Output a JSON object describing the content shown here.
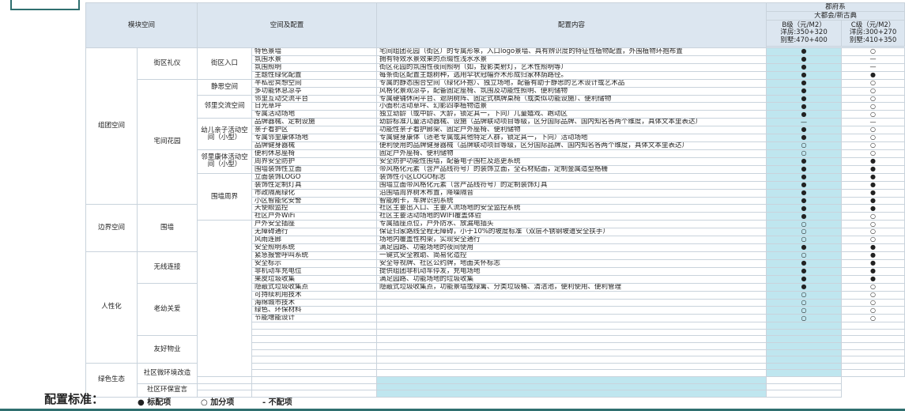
{
  "header": {
    "col_module": "模块空间",
    "col_space": "空间及配置",
    "col_content": "配置内容",
    "series": "郡府系",
    "sub_series": "大都会/新古典",
    "level_b": "B级（元/M2）",
    "level_b_price1": "洋房:350+320",
    "level_b_price2": "别墅:470+400",
    "level_c": "C级（元/M2）",
    "level_c_price1": "洋房:300+270",
    "level_c_price2": "别墅:410+350"
  },
  "groups": [
    {
      "module": "组团空间",
      "rows": 20
    },
    {
      "module": "边界空间",
      "rows": 6
    },
    {
      "module": "人性化",
      "rows": 15
    },
    {
      "module": "绿色生态",
      "rows": 5
    }
  ],
  "subgroups": [
    {
      "name": "街区礼仪",
      "rows": 4
    },
    {
      "name": "宅间花园",
      "rows": 16
    },
    {
      "name": "围墙",
      "rows": 6
    },
    {
      "name": "无线连接",
      "rows": 4
    },
    {
      "name": "老幼关爱",
      "rows": 7
    },
    {
      "name": "友好物业",
      "rows": 4
    },
    {
      "name": "社区微环境改造",
      "rows": 3
    },
    {
      "name": "社区环保宣言",
      "rows": 2
    }
  ],
  "items": [
    {
      "space": "街区入口",
      "rows": 4
    },
    {
      "space": "静思空间",
      "rows": 2
    },
    {
      "space": "邻里交流空间",
      "rows": 3
    },
    {
      "space": "幼儿亲子活动空间（小型）",
      "rows": 4
    },
    {
      "space": "邻里康体活动空间（小型）",
      "rows": 3
    },
    {
      "space": "围墙周界",
      "rows": 6
    }
  ],
  "rows": [
    {
      "config": "特色景墙",
      "content": "宅间组团花园（街区）的专属形象，入口logo景墙、具有辨识度的特征性植物配置，外围植物环抱布置",
      "b": "●",
      "c": "○"
    },
    {
      "config": "氛围水景",
      "content": "拥有特效水景效果的点缀性浅水水景",
      "b": "●",
      "c": "—"
    },
    {
      "config": "氛围照明",
      "content": "街区花园的氛围性夜间照明（如，投影类射灯，艺术性照明等）",
      "b": "●",
      "c": "—"
    },
    {
      "config": "主题性绿化配置",
      "content": "每条街区配置主题树种，选用伞状冠幅乔木形成归家林荫路径。",
      "b": "●",
      "c": "●"
    },
    {
      "config": "半私密冥想空间",
      "content": "专属的静态围合空间（绿化环抱）、独立场地，配备有助于静思的艺术设计或艺术品",
      "b": "●",
      "c": "○"
    },
    {
      "config": "多功能休息凉亭",
      "content": "风格化景观凉亭，配备固定座椅、氛围及功能性照明、便利储物",
      "b": "●",
      "c": "○"
    },
    {
      "config": "邻里互动交流平台",
      "content": "专属硬铺休闲平台、遮阴树阵、固定式棋牌桌椅（或类似功能设施）、便利储物",
      "b": "●",
      "c": "○"
    },
    {
      "config": "日光草坪",
      "content": "小面积活动草坪、幻影四季植物造景",
      "b": "●",
      "c": "○"
    },
    {
      "config": "专属活动场地",
      "content": "独立幼龄（或中龄、大龄，锁定其一，下同）儿童嬉戏、跑动区",
      "b": "●",
      "c": "○"
    },
    {
      "config": "品牌器械、定制设施",
      "content": "幼龄标准儿童活动器械、设施（品牌联动项目等级，区分国际品牌、国内知名各两个维度，具体文本里表达）",
      "b": "—",
      "c": "—"
    },
    {
      "config": "亲子看护区",
      "content": "功能性亲子看护廊架、固定户外座椅、便利储物",
      "b": "●",
      "c": "○"
    },
    {
      "config": "专属邻里康体场地",
      "content": "专属健身康体（适老专属或其他特定人群，锁定其一，下同）活动场地",
      "b": "●",
      "c": "○"
    },
    {
      "config": "品牌健身器械",
      "content": "便利使用的品牌健身器械（品牌联动项目等级，区分国际品牌、国内知名各两个维度，具体文本里表达）",
      "b": "○",
      "c": "○"
    },
    {
      "config": "便利休息座椅",
      "content": "固定户外座椅、便利储物",
      "b": "○",
      "c": "○"
    },
    {
      "config": "周界安全防护",
      "content": "安全防护功能性围墙，配备电子围栏及巡更系统",
      "b": "●",
      "c": "●"
    },
    {
      "config": "围墙装饰性立面",
      "content": "带风格化元素（含产品线符号）的装饰立面，全石材贴面，定制金属造型格栅",
      "b": "●",
      "c": "●"
    },
    {
      "config": "立面装饰LOGO",
      "content": "装饰性小区LOGO标志",
      "b": "●",
      "c": "●"
    },
    {
      "config": "装饰性定制灯具",
      "content": "围墙立面带风格化元素（含产品线符号）的定制装饰灯具",
      "b": "●",
      "c": "●"
    },
    {
      "config": "市政隔离绿化",
      "content": "沿围墙周界树木布置，降噪隔音",
      "b": "●",
      "c": "●"
    },
    {
      "config": "小区智能化安警",
      "content": "智能刷卡，车牌识别系统",
      "b": "●",
      "c": "●"
    },
    {
      "config": "天使眼监控",
      "content": "社区主要出入口、主要人流场地的安全监控系统",
      "b": "●",
      "c": "●"
    },
    {
      "config": "社区户外WiFi",
      "content": "社区主要活动场地的WIFI覆盖体验",
      "b": "●",
      "c": "○"
    },
    {
      "config": "户外安全插座",
      "content": "专属插座点位，户外防水、放漏电插头",
      "b": "○",
      "c": "○"
    },
    {
      "config": "无障碍通行",
      "content": "保证归家路线全程无障碍，小于10%的坡度标准（双层不锈钢坡道安全扶手）",
      "b": "○",
      "c": "○"
    },
    {
      "config": "风雨连廊",
      "content": "场地内覆盖性构架，实现安全通行",
      "b": "○",
      "c": "○"
    },
    {
      "config": "安全照明系统",
      "content": "满足园路、功能场地的夜间使用",
      "b": "●",
      "c": "●"
    },
    {
      "config": "紧急报警呼叫系统",
      "content": "一键式安全救助、简易化造控",
      "b": "○",
      "c": "●"
    },
    {
      "config": "安全标示",
      "content": "安全导视牌、社区公约牌，地面关怀标志",
      "b": "●",
      "c": "●"
    },
    {
      "config": "非机动车充电位",
      "content": "提供组团非机动车停发，充电场地",
      "b": "●",
      "c": "●"
    },
    {
      "config": "果皮垃圾收集",
      "content": "满足园路、功能场地的垃圾收集",
      "b": "●",
      "c": "●"
    },
    {
      "config": "隐蔽式垃圾收集点",
      "content": "隐蔽式垃圾收集点，功能景墙或绿篱、分类垃圾桶、清洁池，便利使用、便利管理",
      "b": "●",
      "c": "○"
    },
    {
      "config": "可持续利用技术",
      "content": "",
      "b": "○",
      "c": "○"
    },
    {
      "config": "海绵城市技术",
      "content": "",
      "b": "○",
      "c": "○"
    },
    {
      "config": "绿色、环保材料",
      "content": "",
      "b": "○",
      "c": "○"
    },
    {
      "config": "节能增能设计",
      "content": "",
      "b": "○",
      "c": "○"
    }
  ],
  "footer": {
    "title": "配置标准：",
    "legend_standard": "● 标配项",
    "legend_bonus": "○ 加分项",
    "legend_none": "- 不配项"
  }
}
